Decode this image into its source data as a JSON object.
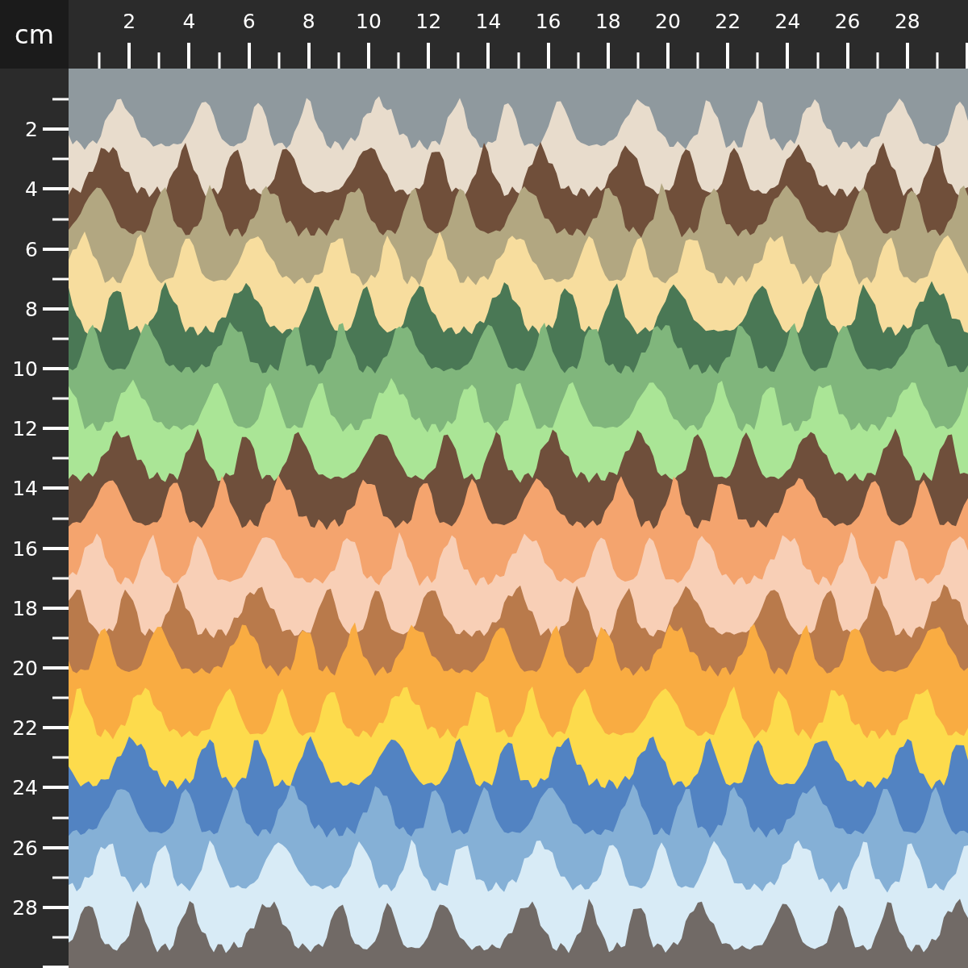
{
  "unit": "cm",
  "top_ruler": {
    "labels": [
      "2",
      "4",
      "6",
      "8",
      "10",
      "12",
      "14",
      "16",
      "18",
      "20",
      "22",
      "24",
      "26",
      "28"
    ]
  },
  "left_ruler": {
    "labels": [
      "2",
      "4",
      "6",
      "8",
      "10",
      "12",
      "14",
      "16",
      "18",
      "20",
      "22",
      "24",
      "26",
      "28"
    ]
  }
}
